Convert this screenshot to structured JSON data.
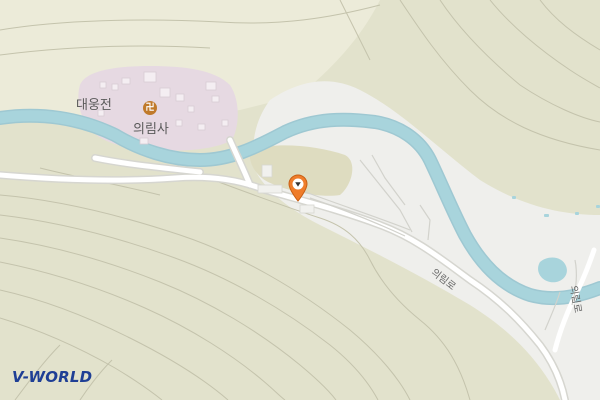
{
  "map": {
    "places": {
      "temple_name": "의림사",
      "hall_name": "대웅전",
      "temple_symbol": "卍"
    },
    "roads": {
      "road_label_1": "의림로",
      "road_label_2": "의림로"
    },
    "branding": {
      "logo_text": "V-WORLD"
    },
    "colors": {
      "terrain": "#e2e2cc",
      "terrain_light": "#ecebd9",
      "contour": "#c4c3ac",
      "urban": "#efefec",
      "temple_area": "#e6d9e2",
      "water": "#a8d4dc",
      "water_edge": "#9ec8d2",
      "road": "#ffffff",
      "road_casing": "#d6d6d0",
      "marker": "#ef7d2b",
      "logo": "#1f3f95"
    },
    "icons": {
      "marker": "location-pin-icon",
      "temple": "buddhist-temple-icon"
    }
  }
}
